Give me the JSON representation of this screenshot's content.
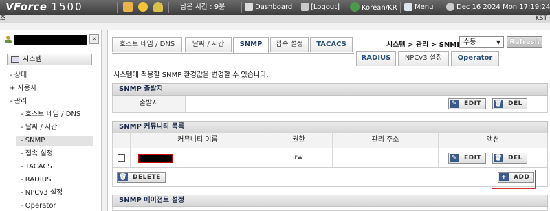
{
  "topbar": {
    "brand": "VForce",
    "model": "1500",
    "remaining_time": "남은 시간 : 9분",
    "dashboard": "Dashboard",
    "logout": "[Logout]",
    "language": "Korean/KR",
    "menu": "Menu",
    "datetime": "Dec 16 2024 Mon 17:19:24"
  },
  "subbar": {
    "left": "조",
    "right": "KST"
  },
  "sidebar": {
    "section": "시스템",
    "items": [
      {
        "label": "- 상태"
      },
      {
        "label": "+ 사용자"
      },
      {
        "label": "- 관리"
      }
    ],
    "sub_items": [
      {
        "label": "- 호스트 네임 / DNS"
      },
      {
        "label": "- 날짜 / 시간"
      },
      {
        "label": "- SNMP"
      },
      {
        "label": "- 접속 설정"
      },
      {
        "label": "- TACACS"
      },
      {
        "label": "- RADIUS"
      },
      {
        "label": "- NPCv3 설정"
      },
      {
        "label": "- Operator"
      }
    ]
  },
  "tabs": {
    "row1": [
      {
        "label": "호스트 네임 / DNS"
      },
      {
        "label": "날짜 / 시간"
      },
      {
        "label": "SNMP"
      },
      {
        "label": "접속 설정"
      },
      {
        "label": "TACACS"
      }
    ],
    "row2": [
      {
        "label": "RADIUS"
      },
      {
        "label": "NPCv3 설정"
      },
      {
        "label": "Operator"
      }
    ]
  },
  "breadcrumb": "시스템 > 관리 > SNMP",
  "refresh_select": "수동",
  "refresh_button": "Refresh",
  "description": "시스템에 적용할 SNMP 환경값을 변경할 수 있습니다.",
  "source_panel": {
    "title": "SNMP 출발지",
    "label": "출발지",
    "edit": "EDIT",
    "del": "DEL"
  },
  "community_panel": {
    "title": "SNMP 커뮤니티 목록",
    "headers": [
      "커뮤니티 이름",
      "권한",
      "관리 주소",
      "액션"
    ],
    "row": {
      "permission": "rw",
      "address": "",
      "edit": "EDIT",
      "del": "DEL"
    },
    "delete": "DELETE",
    "add": "ADD"
  },
  "agent_panel": {
    "title": "SNMP 에이전트 설정"
  }
}
